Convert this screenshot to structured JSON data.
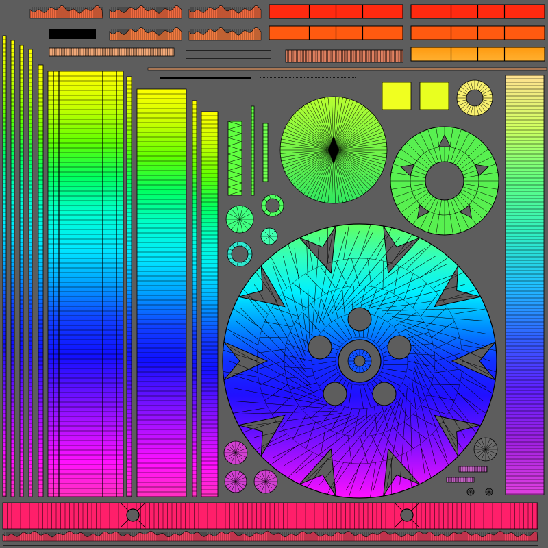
{
  "canvas": {
    "background": "#5d5d5d",
    "wire_color": "#000000"
  },
  "palette": {
    "rainbow": [
      "#ffff00",
      "#c8ff00",
      "#60ff00",
      "#00ff60",
      "#00ffd0",
      "#00e8ff",
      "#00a0ff",
      "#1040ff",
      "#1010ff",
      "#6010ff",
      "#b010ff",
      "#ff10ff",
      "#ff30c0"
    ],
    "reds": [
      "#ff2a10",
      "#ff4a10",
      "#ff7010",
      "#ff9a10",
      "#ffb020"
    ],
    "pink_strip": "#ff1f6a",
    "tan": "#f0a878",
    "magenta": "#d040d0"
  }
}
